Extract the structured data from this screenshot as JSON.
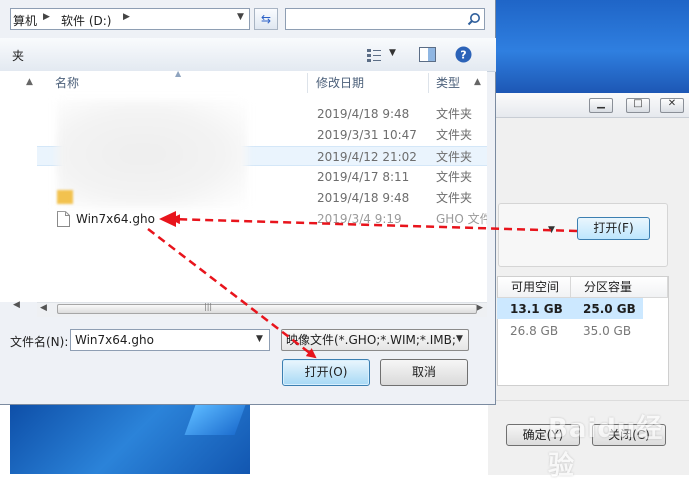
{
  "address": {
    "crumb1": "算机",
    "crumb2": "软件 (D:)"
  },
  "toolbar": {
    "left_label": "夹"
  },
  "columns": {
    "name": "名称",
    "date": "修改日期",
    "type": "类型"
  },
  "files": [
    {
      "name": "",
      "date": "2019/4/18 9:48",
      "type": "文件夹"
    },
    {
      "name": "",
      "date": "2019/3/31 10:47",
      "type": "文件夹"
    },
    {
      "name": "",
      "date": "2019/4/12 21:02",
      "type": "文件夹"
    },
    {
      "name": "",
      "date": "2019/4/17 8:11",
      "type": "文件夹"
    },
    {
      "name": "",
      "date": "2019/4/18 9:48",
      "type": "文件夹"
    },
    {
      "name": "Win7x64.gho",
      "date": "2019/3/4 9:19",
      "type": "GHO 文件"
    }
  ],
  "filename": {
    "label": "文件名(N):",
    "value": "Win7x64.gho"
  },
  "filetype": {
    "value": "映像文件(*.GHO;*.WIM;*.IMB;"
  },
  "buttons": {
    "open": "打开(O)",
    "cancel": "取消"
  },
  "background": {
    "open_button": "打开(F)",
    "table": {
      "headers": [
        "可用空间",
        "分区容量"
      ],
      "rows": [
        [
          "13.1 GB",
          "25.0 GB"
        ],
        [
          "26.8 GB",
          "35.0 GB"
        ]
      ]
    },
    "ok_button": "确定(Y)",
    "close_button": "关闭(C)"
  },
  "watermark": "Baidu经验",
  "colors": {
    "arrow": "#e8141c",
    "selection": "#cce8ff",
    "aero": "#2f7fe0"
  }
}
